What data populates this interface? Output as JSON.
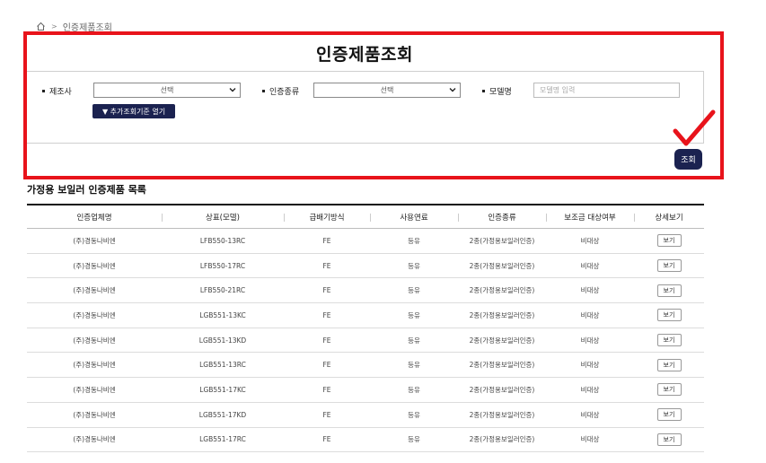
{
  "breadcrumb": {
    "current": "인증제품조회"
  },
  "page_title": "인증제품조회",
  "search": {
    "manufacturer_label": "제조사",
    "manufacturer_value": "선택",
    "cert_type_label": "인증종류",
    "cert_type_value": "선택",
    "model_label": "모델명",
    "model_placeholder": "모델명 입력",
    "toggle_label": "▼ 추가조회기준 열기",
    "search_button": "조회"
  },
  "list_title": "가정용 보일러 인증제품 목록",
  "table": {
    "headers": [
      "인증업체명",
      "상표(모델)",
      "급배기방식",
      "사용연료",
      "인증종류",
      "보조금 대상여부",
      "상세보기"
    ],
    "view_label": "보기",
    "rows": [
      [
        "(주)경동나비엔",
        "LFB550-13RC",
        "FE",
        "등유",
        "2종(가정용보일러인증)",
        "비대상"
      ],
      [
        "(주)경동나비엔",
        "LFB550-17RC",
        "FE",
        "등유",
        "2종(가정용보일러인증)",
        "비대상"
      ],
      [
        "(주)경동나비엔",
        "LFB550-21RC",
        "FE",
        "등유",
        "2종(가정용보일러인증)",
        "비대상"
      ],
      [
        "(주)경동나비엔",
        "LGB551-13KC",
        "FE",
        "등유",
        "2종(가정용보일러인증)",
        "비대상"
      ],
      [
        "(주)경동나비엔",
        "LGB551-13KD",
        "FE",
        "등유",
        "2종(가정용보일러인증)",
        "비대상"
      ],
      [
        "(주)경동나비엔",
        "LGB551-13RC",
        "FE",
        "등유",
        "2종(가정용보일러인증)",
        "비대상"
      ],
      [
        "(주)경동나비엔",
        "LGB551-17KC",
        "FE",
        "등유",
        "2종(가정용보일러인증)",
        "비대상"
      ],
      [
        "(주)경동나비엔",
        "LGB551-17KD",
        "FE",
        "등유",
        "2종(가정용보일러인증)",
        "비대상"
      ],
      [
        "(주)경동나비엔",
        "LGB551-17RC",
        "FE",
        "등유",
        "2종(가정용보일러인증)",
        "비대상"
      ]
    ]
  },
  "colors": {
    "highlight": "#e8131b",
    "primary_button": "#1b2250"
  },
  "icons": {
    "home": "home-icon",
    "check": "check-mark-icon",
    "select": "chevron-down-icon"
  }
}
